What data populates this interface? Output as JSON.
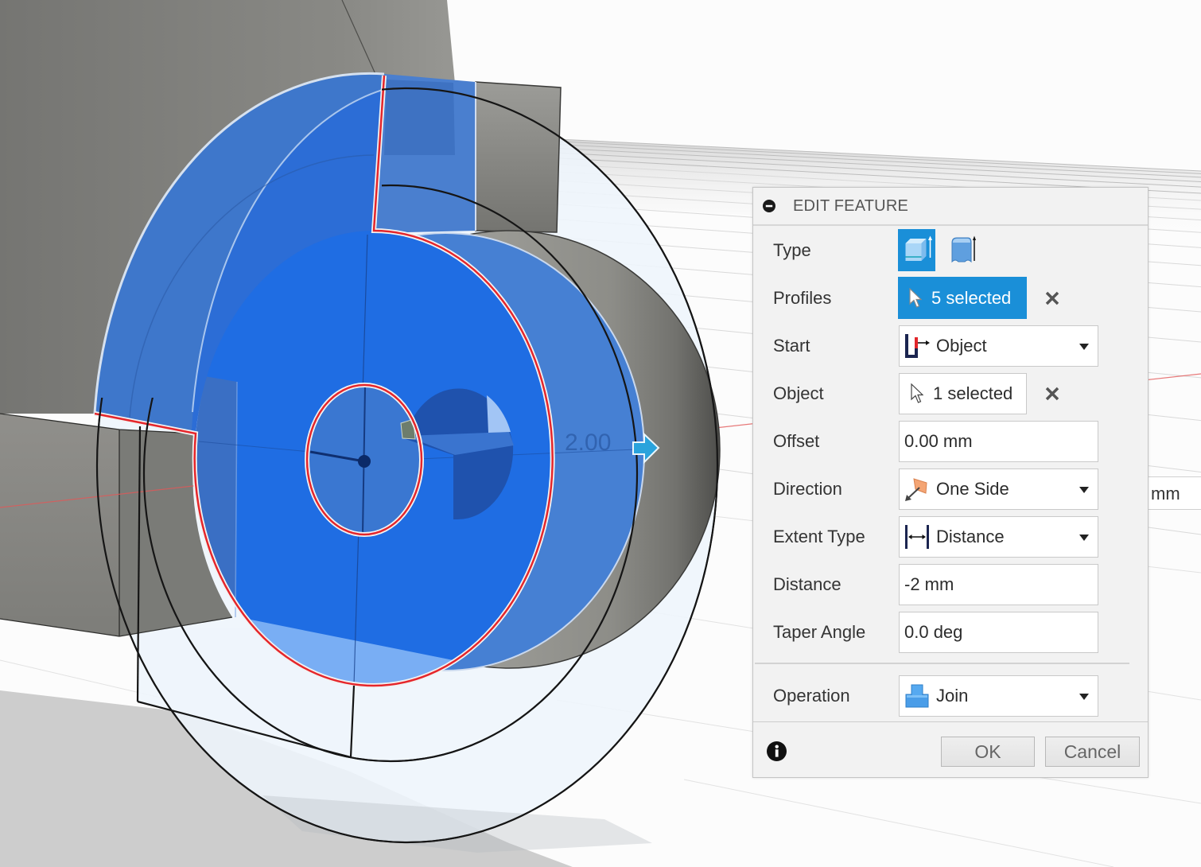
{
  "viewport": {
    "dimension_label": "2.00",
    "manipulator_input_unit": "mm",
    "selected_profiles": 5
  },
  "dialog": {
    "title": "EDIT FEATURE",
    "collapse_icon": "minus-circle-icon",
    "type": {
      "label": "Type",
      "options": [
        {
          "icon": "solid-extrude-icon",
          "selected": true
        },
        {
          "icon": "thin-extrude-icon",
          "selected": false
        }
      ]
    },
    "profiles": {
      "label": "Profiles",
      "value": "5 selected",
      "icon": "select-cursor-icon",
      "active": true
    },
    "start": {
      "label": "Start",
      "value": "Object",
      "icon": "start-object-icon"
    },
    "object": {
      "label": "Object",
      "value": "1 selected",
      "icon": "select-cursor-icon",
      "active": false
    },
    "offset": {
      "label": "Offset",
      "value": "0.00 mm"
    },
    "direction": {
      "label": "Direction",
      "value": "One Side",
      "icon": "one-side-direction-icon"
    },
    "extent_type": {
      "label": "Extent Type",
      "value": "Distance",
      "icon": "distance-extent-icon"
    },
    "distance": {
      "label": "Distance",
      "value": "-2 mm"
    },
    "taper_angle": {
      "label": "Taper Angle",
      "value": "0.0 deg"
    },
    "operation": {
      "label": "Operation",
      "value": "Join",
      "icon": "join-operation-icon"
    },
    "buttons": {
      "ok": "OK",
      "cancel": "Cancel"
    },
    "footer_icon": "info-icon"
  },
  "colors": {
    "accent": "#1a8fd8",
    "selected_face": "#1f6de3",
    "extrude_preview": "#3e77cb",
    "profile_outline": "#e5262b",
    "body_gray": "#8a8a86",
    "panel_background": "#f2f2f2"
  }
}
